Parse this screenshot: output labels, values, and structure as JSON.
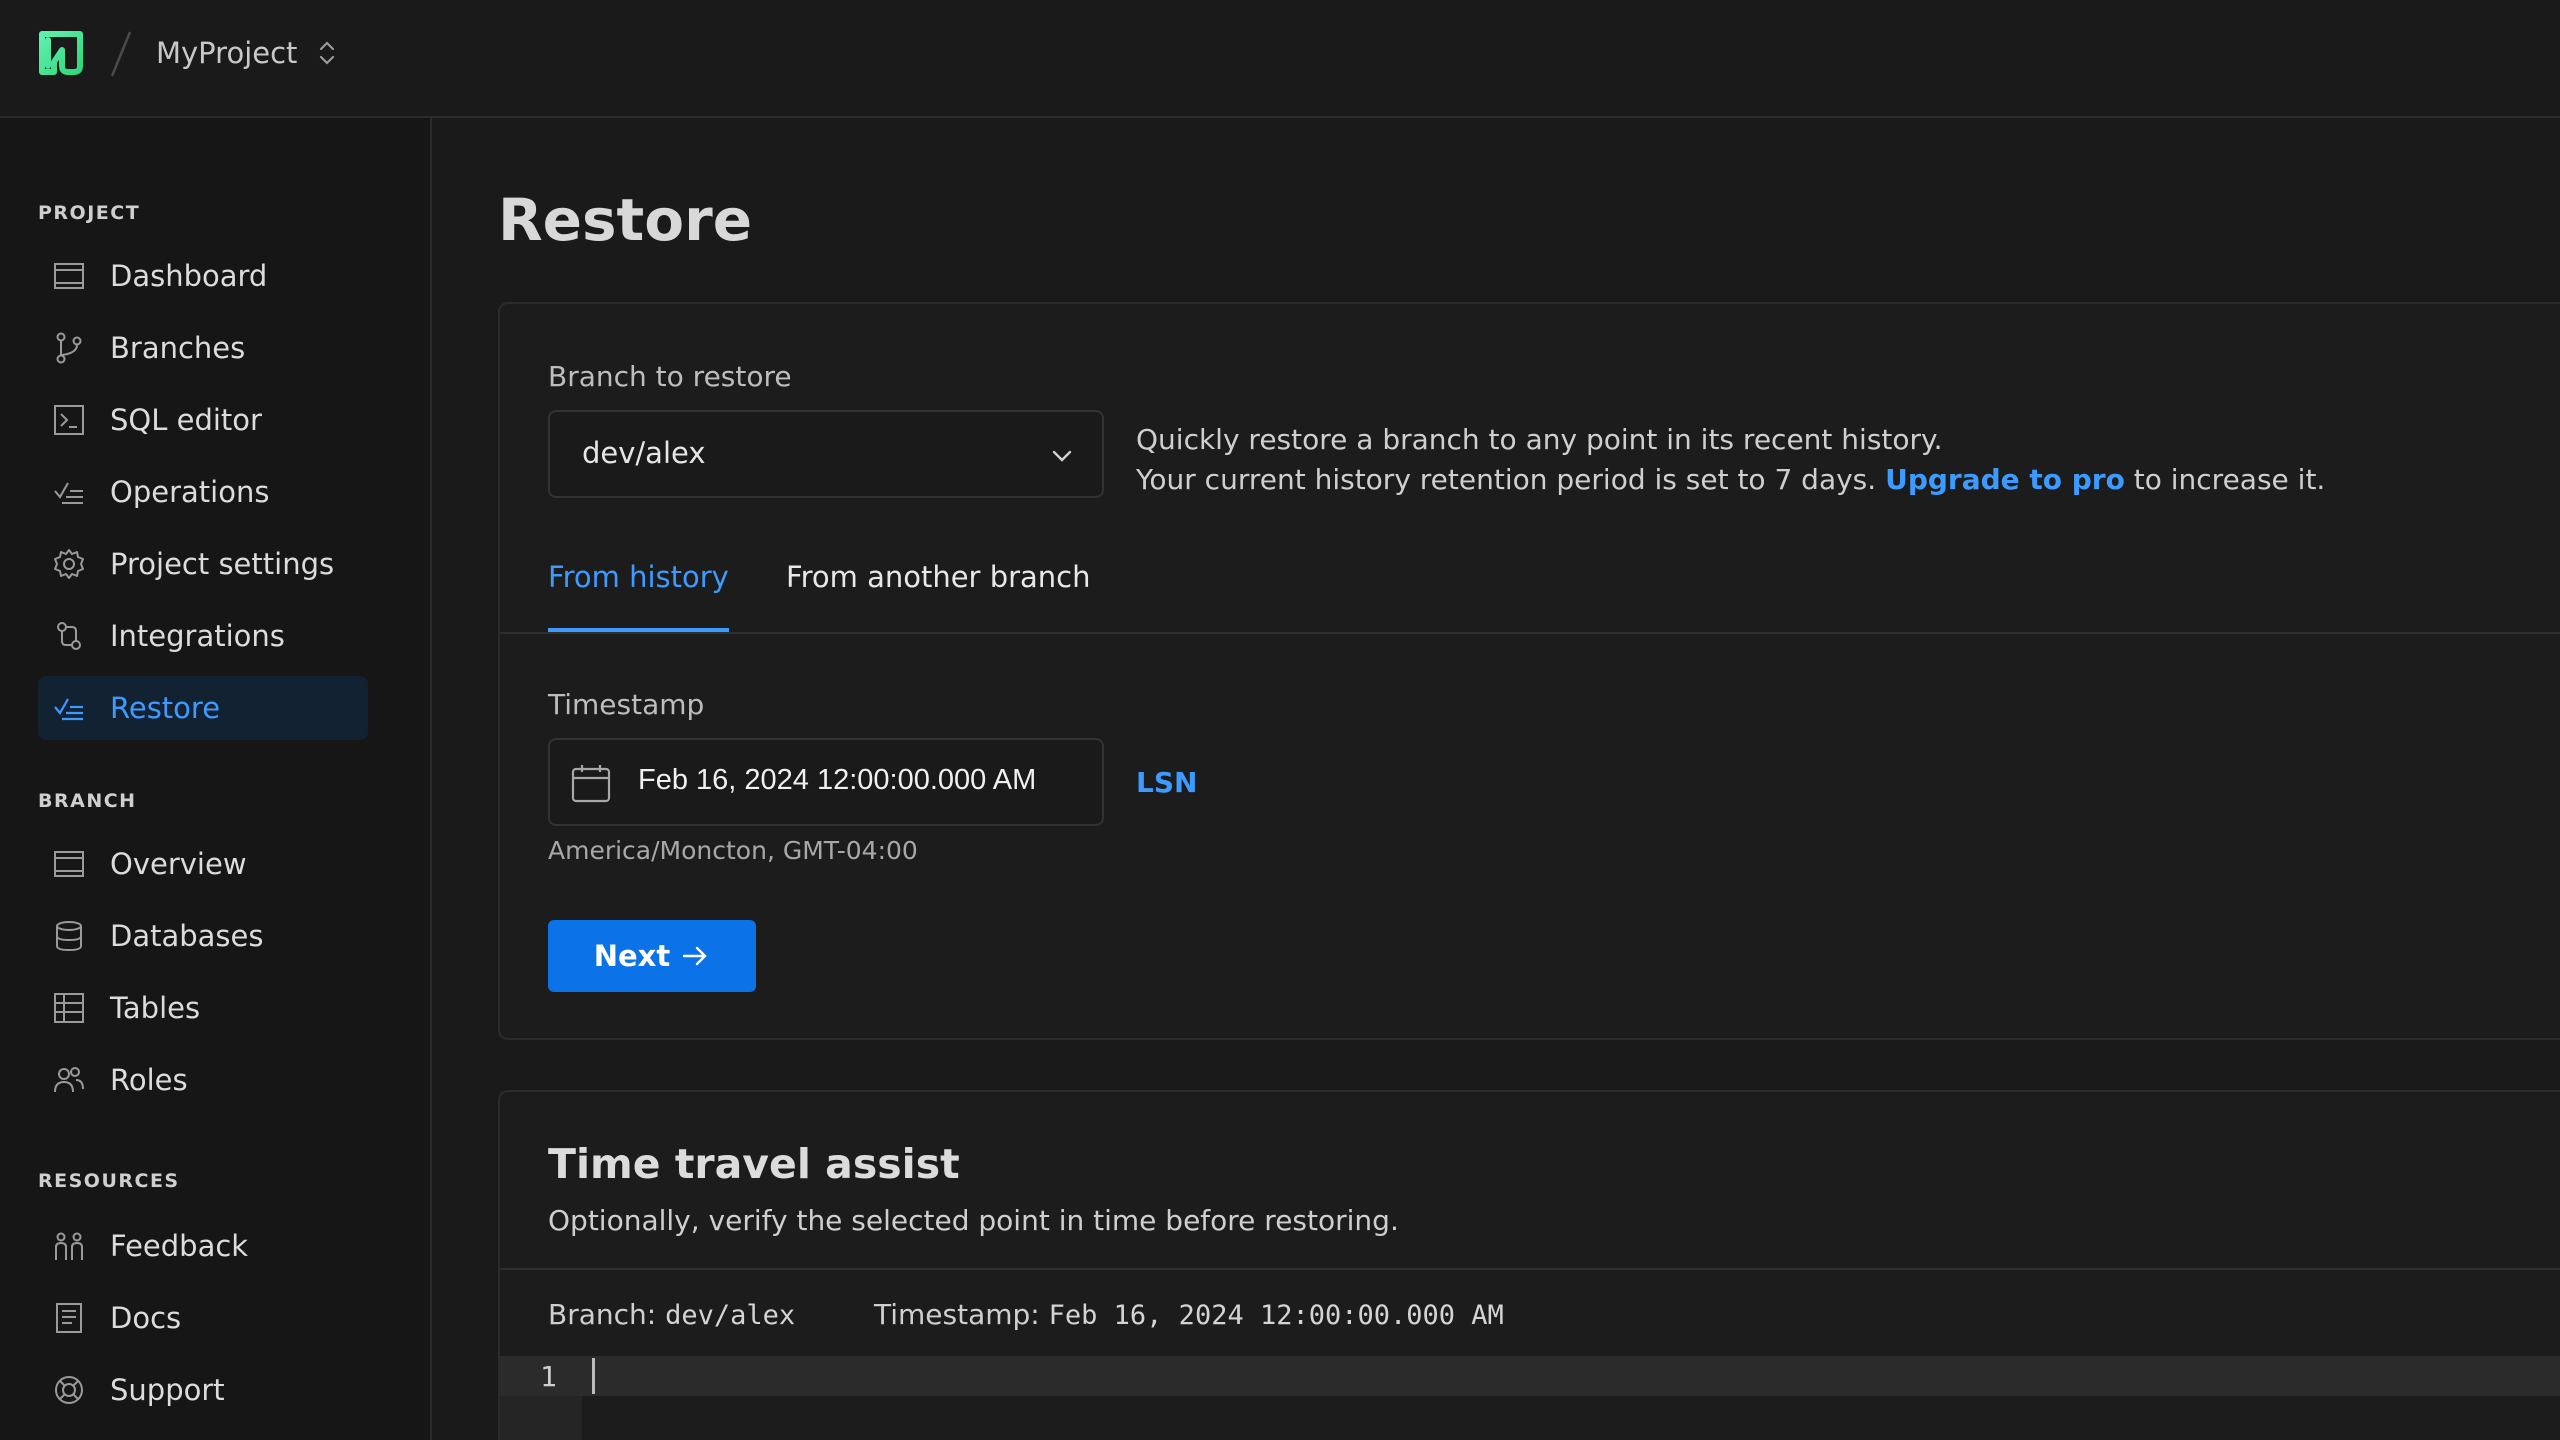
{
  "topbar": {
    "project_name": "MyProject"
  },
  "sidebar": {
    "sections": {
      "project": "PROJECT",
      "branch": "BRANCH",
      "resources": "RESOURCES"
    },
    "project_items": [
      {
        "label": "Dashboard",
        "icon": "dashboard-icon"
      },
      {
        "label": "Branches",
        "icon": "branch-icon"
      },
      {
        "label": "SQL editor",
        "icon": "sql-editor-icon"
      },
      {
        "label": "Operations",
        "icon": "operations-icon"
      },
      {
        "label": "Project settings",
        "icon": "gear-icon"
      },
      {
        "label": "Integrations",
        "icon": "integrations-icon"
      },
      {
        "label": "Restore",
        "icon": "restore-icon",
        "active": true
      }
    ],
    "branch_items": [
      {
        "label": "Overview",
        "icon": "overview-icon"
      },
      {
        "label": "Databases",
        "icon": "database-icon"
      },
      {
        "label": "Tables",
        "icon": "table-icon"
      },
      {
        "label": "Roles",
        "icon": "roles-icon"
      }
    ],
    "resource_items": [
      {
        "label": "Feedback",
        "icon": "feedback-icon"
      },
      {
        "label": "Docs",
        "icon": "docs-icon"
      },
      {
        "label": "Support",
        "icon": "support-icon"
      }
    ]
  },
  "main": {
    "title": "Restore",
    "branch_label": "Branch to restore",
    "branch_value": "dev/alex",
    "desc_line1": "Quickly restore a branch to any point in its recent history.",
    "desc_line2_pre": "Your current history retention period is set to 7 days.",
    "desc_link": "Upgrade to pro",
    "desc_line2_post": "to increase it.",
    "tabs": [
      {
        "label": "From history",
        "active": true
      },
      {
        "label": "From another branch",
        "active": false
      }
    ],
    "timestamp_label": "Timestamp",
    "timestamp_value": "Feb 16, 2024 12:00:00.000 AM",
    "lsn_link": "LSN",
    "timezone": "America/Moncton, GMT-04:00",
    "next_button": "Next"
  },
  "time_travel": {
    "title": "Time travel assist",
    "subtitle": "Optionally, verify the selected point in time before restoring.",
    "branch_key": "Branch:",
    "branch_val": "dev/alex",
    "timestamp_key": "Timestamp:",
    "timestamp_val": "Feb 16, 2024 12:00:00.000 AM",
    "line_number": "1"
  },
  "colors": {
    "accent": "#3d9bff",
    "button": "#0b72e7",
    "brand": "#37e08a"
  }
}
